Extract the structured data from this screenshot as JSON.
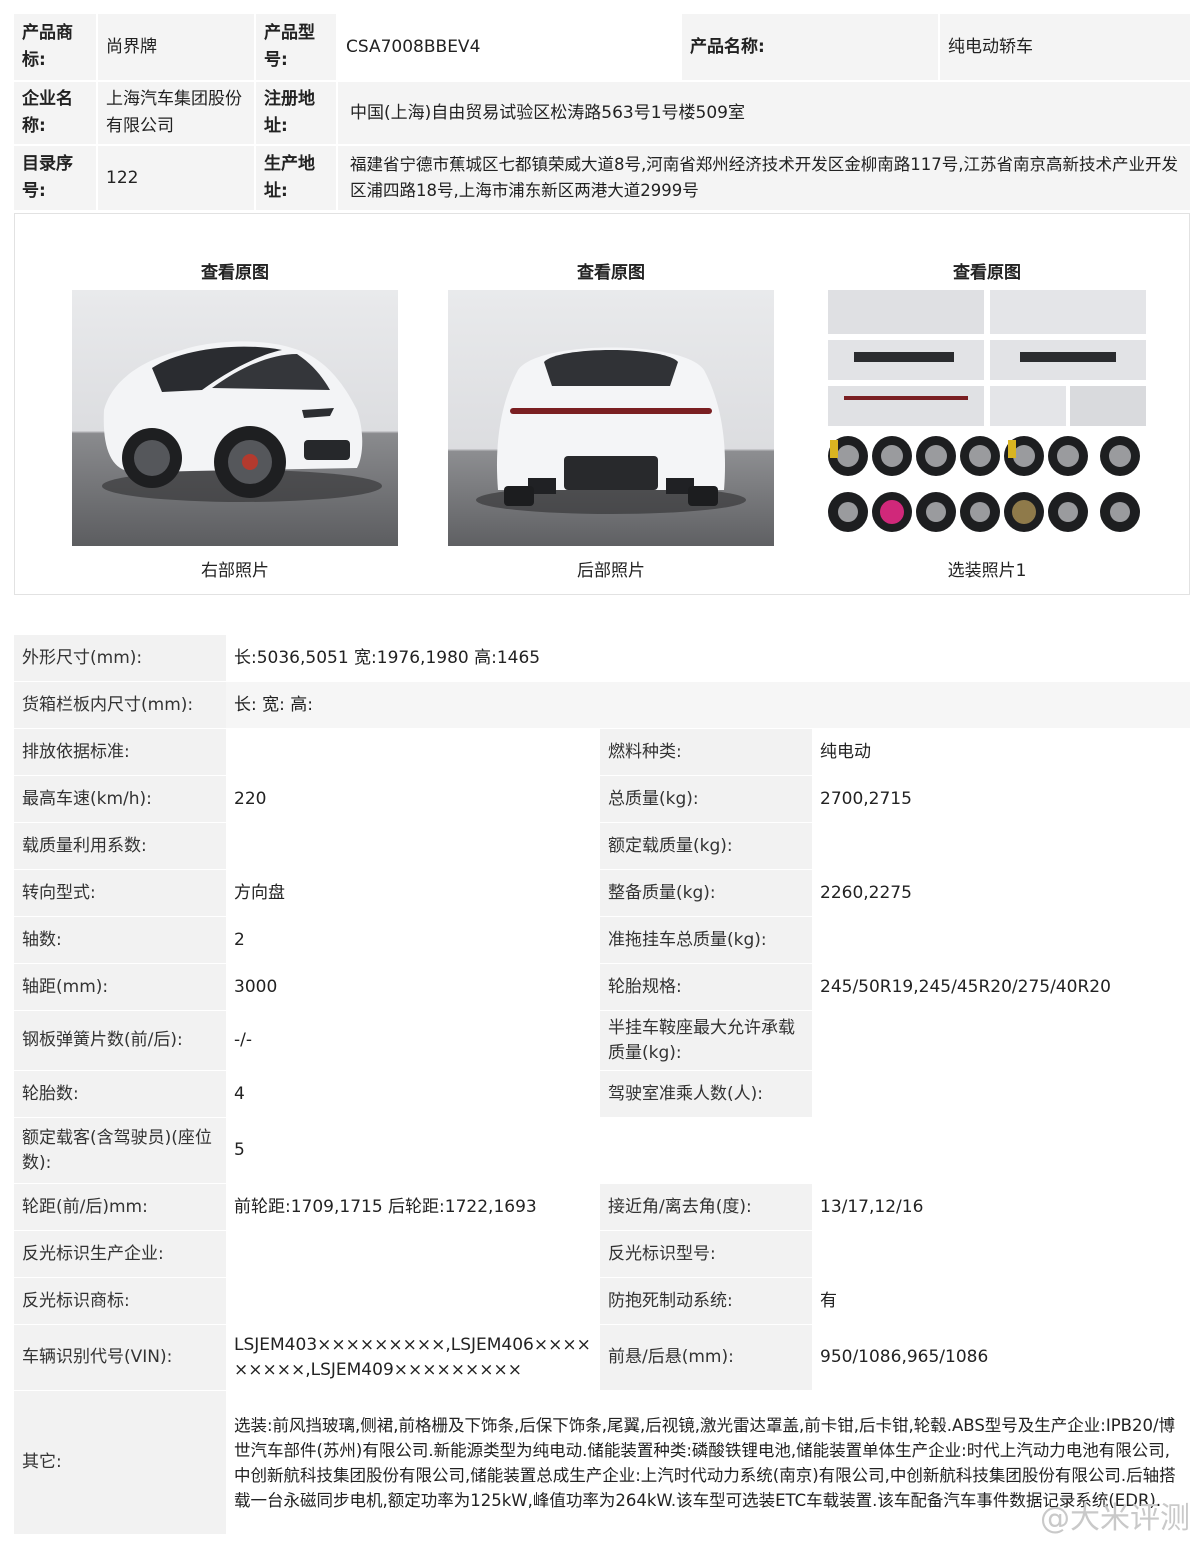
{
  "top_table": {
    "row1": {
      "brand_label": "产品商标:",
      "brand_value": "尚界牌",
      "model_label": "产品型号:",
      "model_value": "CSA7008BBEV4",
      "name_label": "产品名称:",
      "name_value": "纯电动轿车"
    },
    "row2": {
      "company_label": "企业名称:",
      "company_value": "上海汽车集团股份有限公司",
      "address_label": "注册地址:",
      "address_value": "中国(上海)自由贸易试验区松涛路563号1号楼509室"
    },
    "row3": {
      "catalog_label": "目录序号:",
      "catalog_value": "122",
      "production_label": "生产地址:",
      "production_value": "福建省宁德市蕉城区七都镇荣威大道8号,河南省郑州经济技术开发区金柳南路117号,江苏省南京高新技术产业开发区浦四路18号,上海市浦东新区两港大道2999号"
    }
  },
  "photos": [
    {
      "link": "查看原图",
      "caption": "右部照片"
    },
    {
      "link": "查看原图",
      "caption": "后部照片"
    },
    {
      "link": "查看原图",
      "caption": "选装照片1"
    }
  ],
  "specs": {
    "dim_label": "外形尺寸(mm):",
    "dim_value": "长:5036,5051 宽:1976,1980 高:1465",
    "cargo_label": "货箱栏板内尺寸(mm):",
    "cargo_value": "长: 宽: 高:",
    "emission_label": "排放依据标准:",
    "emission_value": "",
    "fuel_label": "燃料种类:",
    "fuel_value": "纯电动",
    "speed_label": "最高车速(km/h):",
    "speed_value": "220",
    "total_mass_label": "总质量(kg):",
    "total_mass_value": "2700,2715",
    "load_util_label": "载质量利用系数:",
    "load_util_value": "",
    "rated_load_label": "额定载质量(kg):",
    "rated_load_value": "",
    "steering_label": "转向型式:",
    "steering_value": "方向盘",
    "curb_label": "整备质量(kg):",
    "curb_value": "2260,2275",
    "axles_label": "轴数:",
    "axles_value": "2",
    "trailer_label": "准拖挂车总质量(kg):",
    "trailer_value": "",
    "wheelbase_label": "轴距(mm):",
    "wheelbase_value": "3000",
    "tire_spec_label": "轮胎规格:",
    "tire_spec_value": "245/50R19,245/45R20/275/40R20",
    "leaf_label": "钢板弹簧片数(前/后):",
    "leaf_value": "-/-",
    "saddle_label": "半挂车鞍座最大允许承载质量(kg):",
    "saddle_value": "",
    "tires_label": "轮胎数:",
    "tires_value": "4",
    "cab_label": "驾驶室准乘人数(人):",
    "cab_value": "",
    "seats_label": "额定载客(含驾驶员)(座位数):",
    "seats_value": "5",
    "track_label": "轮距(前/后)mm:",
    "track_value": "前轮距:1709,1715 后轮距:1722,1693",
    "angle_label": "接近角/离去角(度):",
    "angle_value": "13/17,12/16",
    "refl_maker_label": "反光标识生产企业:",
    "refl_maker_value": "",
    "refl_model_label": "反光标识型号:",
    "refl_model_value": "",
    "refl_brand_label": "反光标识商标:",
    "refl_brand_value": "",
    "abs_label": "防抱死制动系统:",
    "abs_value": "有",
    "vin_label": "车辆识别代号(VIN):",
    "vin_value": "LSJEM403×××××××××,LSJEM406×××××××××,LSJEM409×××××××××",
    "overhang_label": "前悬/后悬(mm):",
    "overhang_value": "950/1086,965/1086",
    "other_label": "其它:",
    "other_value": "选装:前风挡玻璃,侧裙,前格栅及下饰条,后保下饰条,尾翼,后视镜,激光雷达罩盖,前卡钳,后卡钳,轮毂.ABS型号及生产企业:IPB20/博世汽车部件(苏州)有限公司.新能源类型为纯电动.储能装置种类:磷酸铁锂电池,储能装置单体生产企业:时代上汽动力电池有限公司,中创新航科技集团股份有限公司,储能装置总成生产企业:上汽时代动力系统(南京)有限公司,中创新航科技集团股份有限公司.后轴搭载一台永磁同步电机,额定功率为125kW,峰值功率为264kW.该车型可选装ETC车载装置.该车配备汽车事件数据记录系统(EDR)."
  },
  "watermark": "@大米评测"
}
